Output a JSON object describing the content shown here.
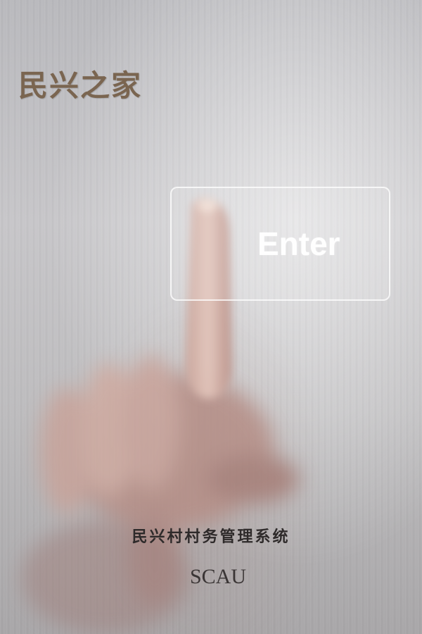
{
  "header": {
    "app_title": "民兴之家"
  },
  "main": {
    "enter_button_label": "Enter"
  },
  "footer": {
    "system_name": "民兴村村务管理系统",
    "organization": "SCAU"
  },
  "colors": {
    "title": "#7a6550",
    "background": "#c0bfc2",
    "button_border": "#ffffff",
    "footer_text": "#2e2a2a"
  }
}
